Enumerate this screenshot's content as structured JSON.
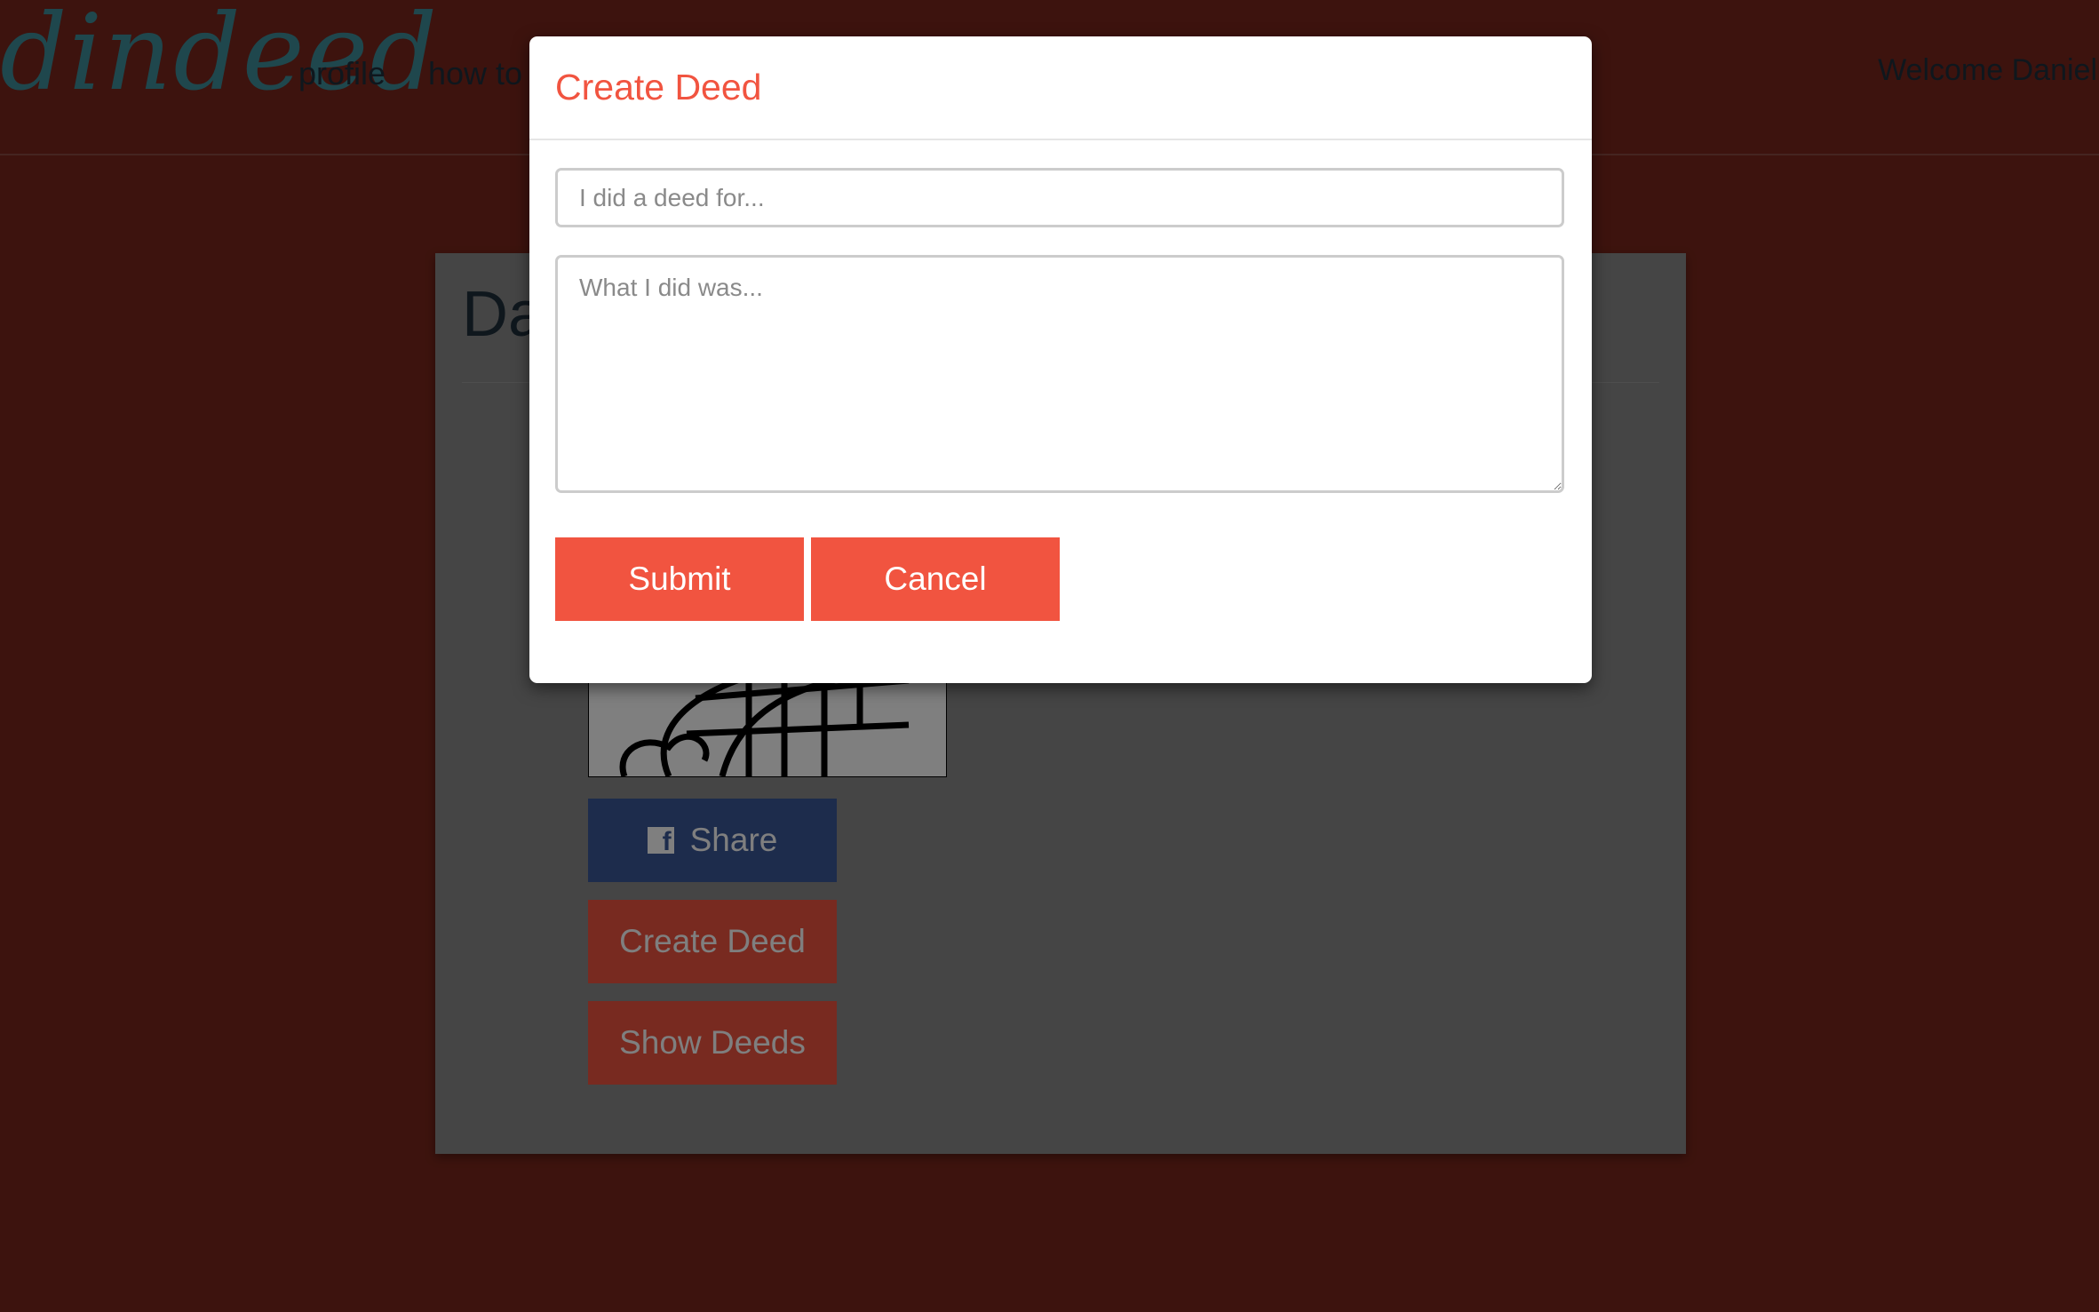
{
  "navbar": {
    "logo": "dindeed",
    "links": [
      "profile",
      "how to"
    ],
    "welcome": "Welcome Daniel"
  },
  "profile_card": {
    "title": "Da",
    "share_label": "Share",
    "create_deed_label": "Create Deed",
    "show_deeds_label": "Show Deeds"
  },
  "modal": {
    "title": "Create Deed",
    "deed_for_placeholder": "I did a deed for...",
    "deed_what_placeholder": "What I did was...",
    "submit_label": "Submit",
    "cancel_label": "Cancel"
  },
  "colors": {
    "accent": "#f15440",
    "facebook": "#3b5998",
    "page_background": "#7a271c"
  }
}
